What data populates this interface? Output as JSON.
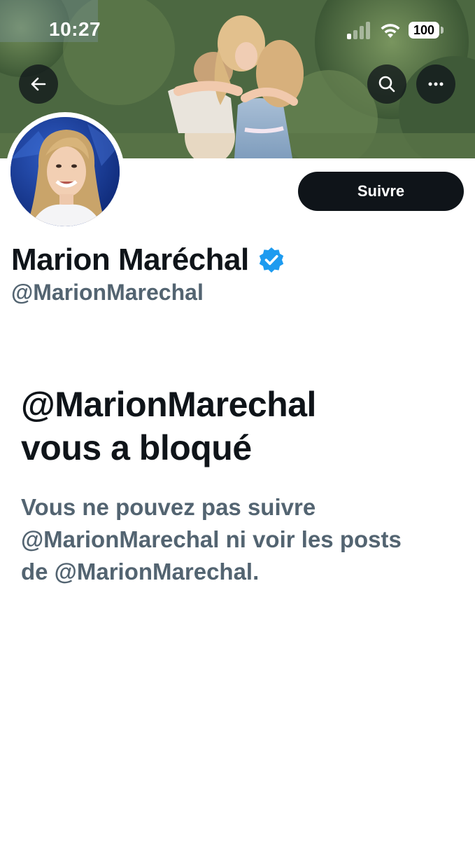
{
  "status_bar": {
    "time": "10:27",
    "battery": "100"
  },
  "header": {
    "back_icon": "arrow-left-icon",
    "search_icon": "search-icon",
    "more_icon": "more-horizontal-icon"
  },
  "profile": {
    "name": "Marion Maréchal",
    "handle": "@MarionMarechal",
    "verified_icon": "verified-badge-icon",
    "verified_color": "#1d9bf0",
    "follow_label": "Suivre"
  },
  "blocked": {
    "title_line1": "@MarionMarechal",
    "title_line2": "vous a bloqué",
    "desc_line1": "Vous ne pouvez pas suivre",
    "desc_line2": "@MarionMarechal ni voir les posts",
    "desc_line3": "de @MarionMarechal."
  },
  "colors": {
    "text_primary": "#0f1419",
    "text_secondary": "#536471",
    "button_dark": "#0f1419",
    "background": "#ffffff"
  }
}
